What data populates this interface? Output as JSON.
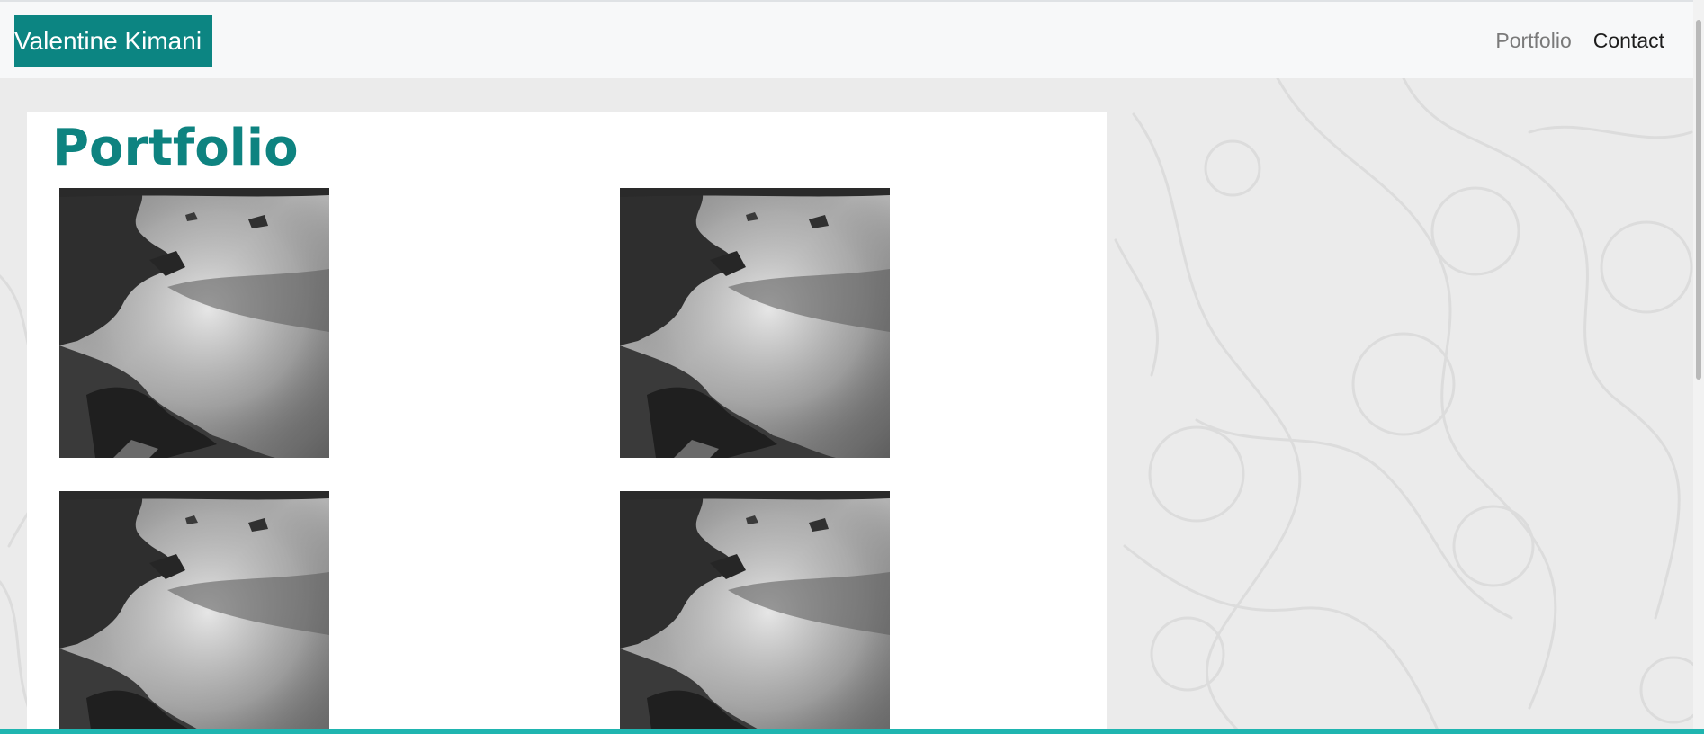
{
  "navbar": {
    "brand": "Valentine Kimani",
    "links": [
      {
        "label": "Portfolio"
      },
      {
        "label": "Contact"
      }
    ]
  },
  "main": {
    "title": "Portfolio",
    "gallery": [
      {
        "image": "coastal rocks and misty sea, black and white"
      },
      {
        "image": "coastal rocks and misty sea, black and white"
      },
      {
        "image": "coastal rocks and misty sea, black and white"
      },
      {
        "image": "coastal rocks and misty sea, black and white"
      }
    ]
  },
  "colors": {
    "brand_bg": "#0c8582",
    "title": "#0e8380",
    "accent_bar": "#1fb5b0",
    "page_bg": "#ebebeb"
  }
}
